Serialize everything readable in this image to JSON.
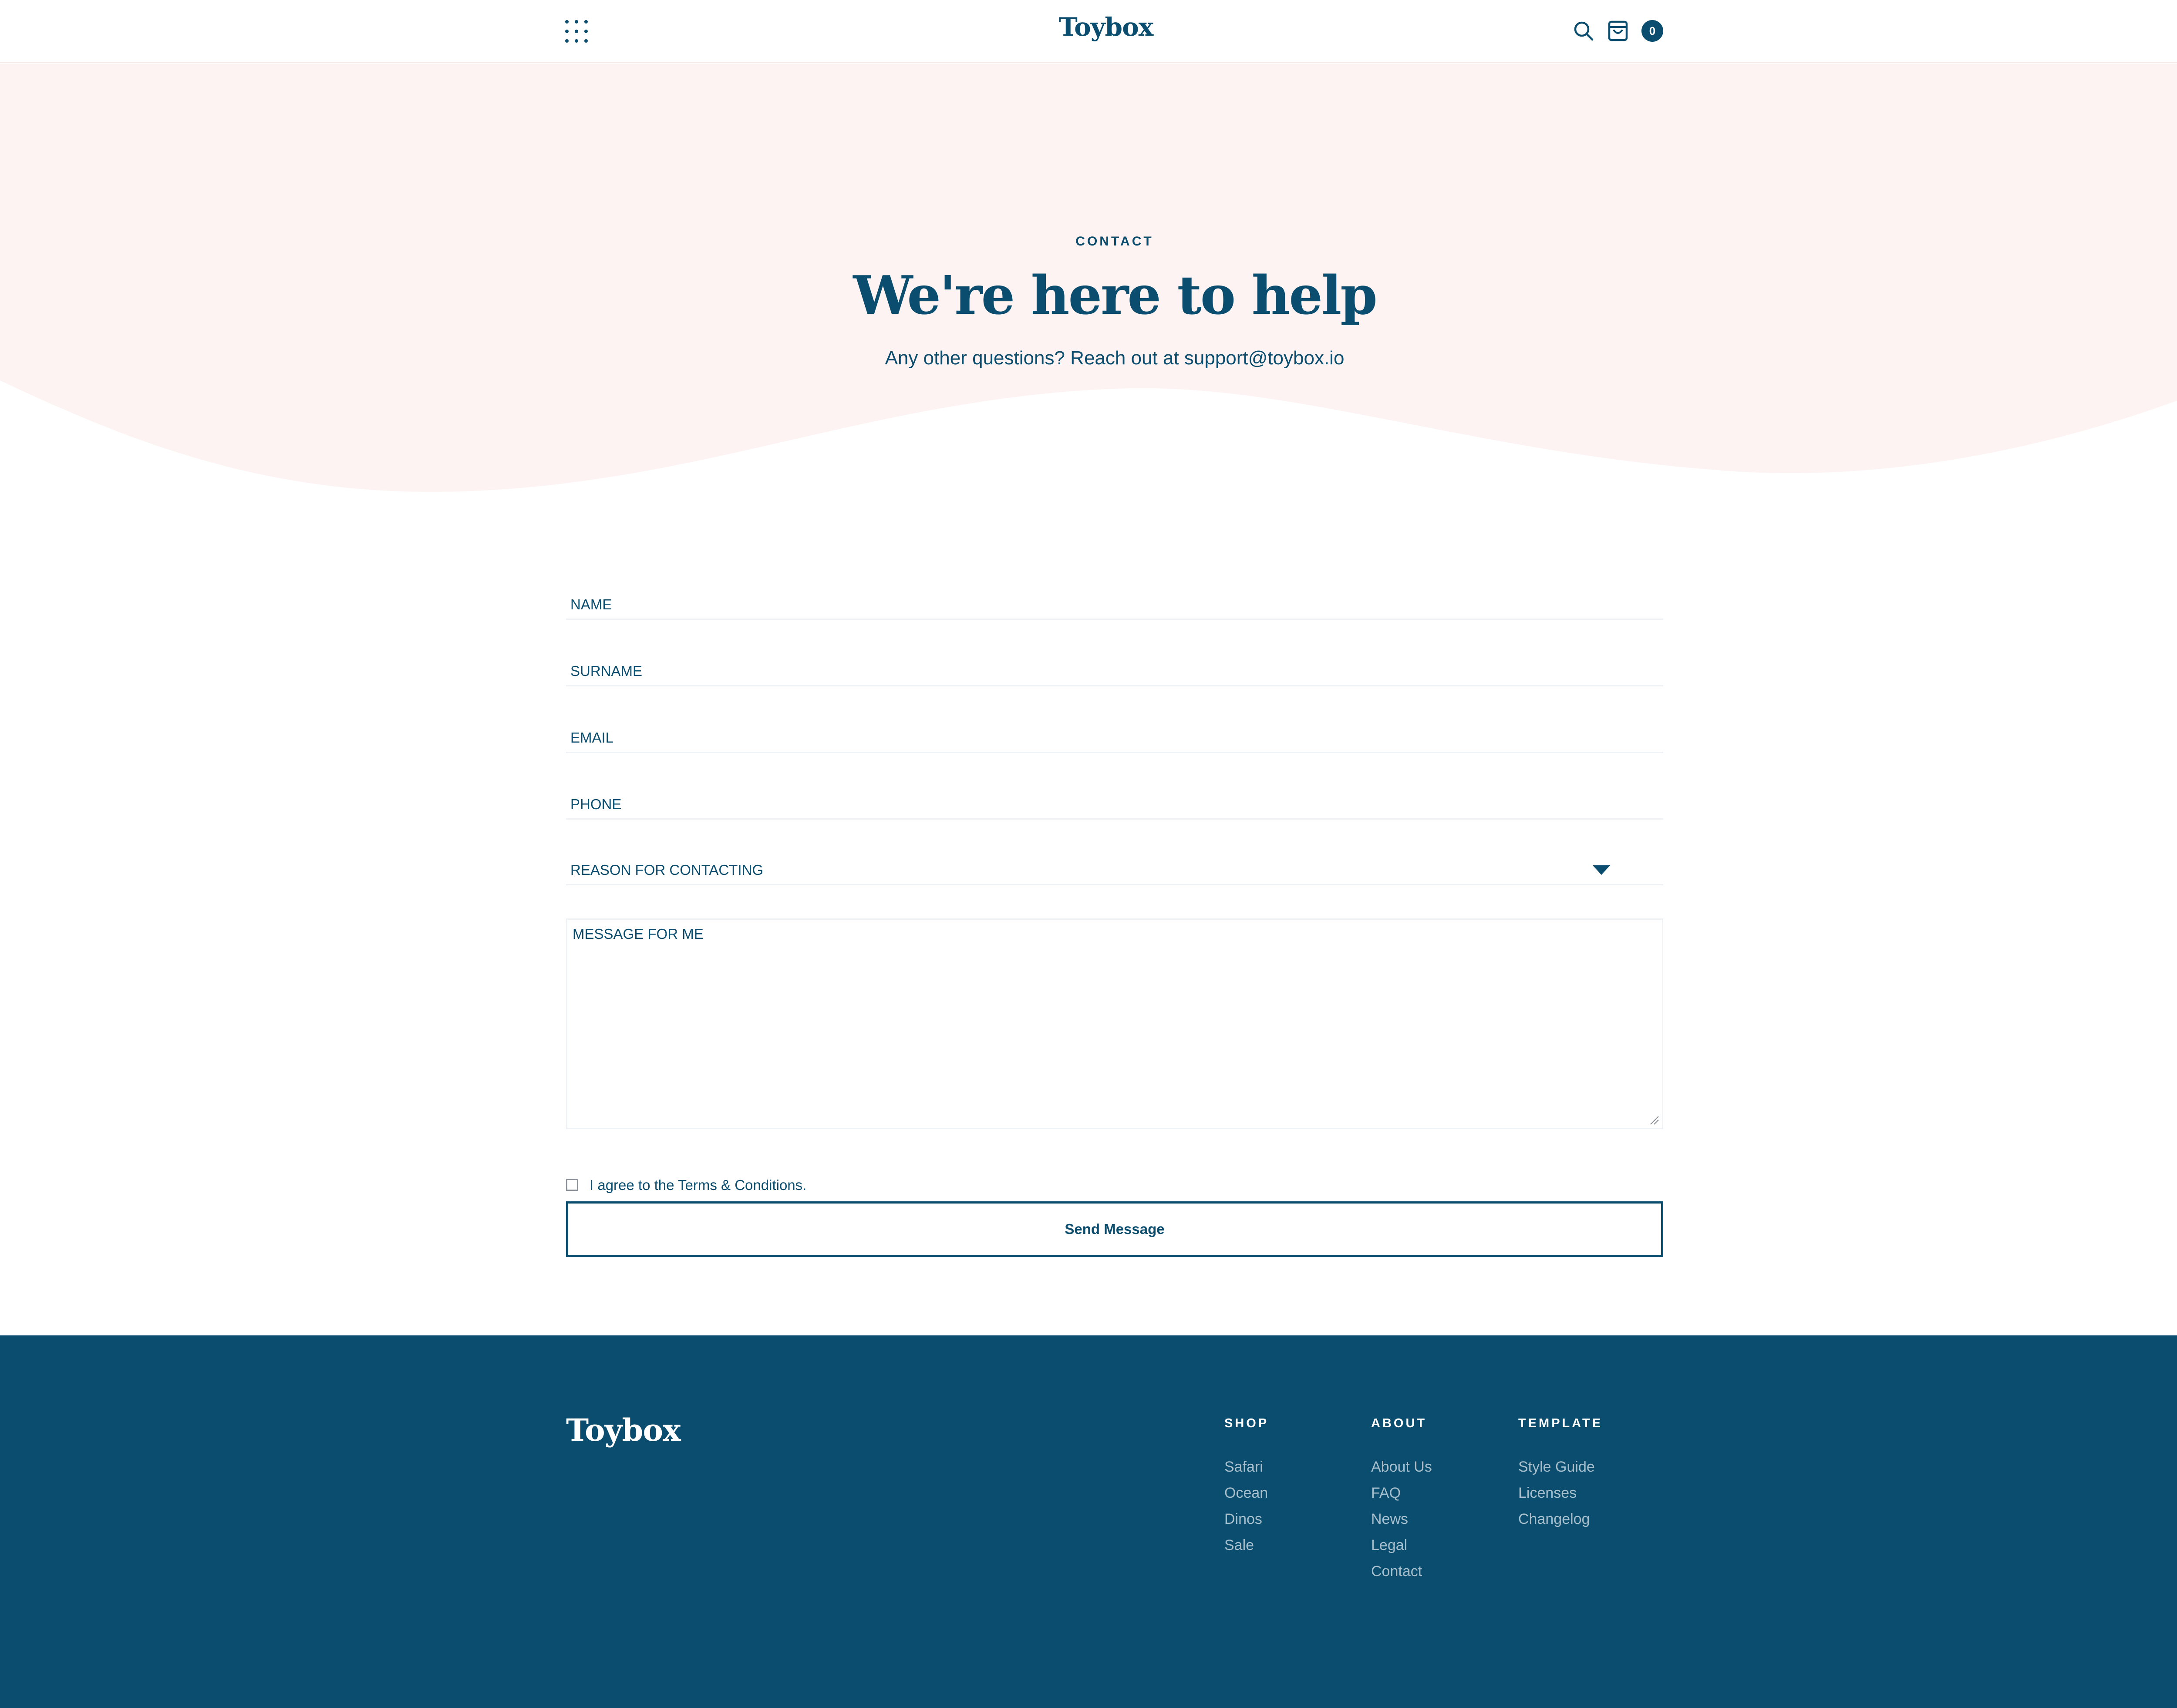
{
  "header": {
    "brand": "Toybox",
    "menu_icon": "grid-dots-icon",
    "search_icon": "search-icon",
    "cart_icon": "shopping-bag-icon",
    "cart_count": "0"
  },
  "hero": {
    "eyebrow": "CONTACT",
    "title": "We're here to help",
    "subtitle": "Any other questions? Reach out at support@toybox.io",
    "background_color": "#fdf3f2"
  },
  "form": {
    "name_label": "NAME",
    "surname_label": "SURNAME",
    "email_label": "EMAIL",
    "phone_label": "PHONE",
    "reason_label": "REASON FOR CONTACTING",
    "message_label": "MESSAGE FOR ME",
    "agree_text": "I agree to the Terms & Conditions.",
    "submit_label": "Send Message"
  },
  "footer": {
    "brand": "Toybox",
    "background_color": "#0a4d6e",
    "columns": [
      {
        "heading": "SHOP",
        "links": [
          "Safari",
          "Ocean",
          "Dinos",
          "Sale"
        ]
      },
      {
        "heading": "ABOUT",
        "links": [
          "About Us",
          "FAQ",
          "News",
          "Legal",
          "Contact"
        ]
      },
      {
        "heading": "TEMPLATE",
        "links": [
          "Style Guide",
          "Licenses",
          "Changelog"
        ]
      }
    ]
  },
  "colors": {
    "primary": "#0a4d6e",
    "hero_background": "#fdf3f2",
    "footer_link": "#a7bfcc"
  }
}
